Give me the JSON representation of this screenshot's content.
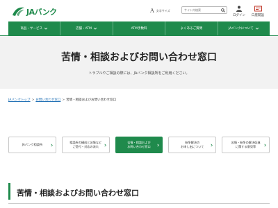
{
  "header": {
    "logo_text": "JAバンク",
    "font_size_label": "文字サイズ",
    "font_size_glyph": "A",
    "search": {
      "placeholder": "サイト内検索"
    },
    "login_label": "ログイン",
    "account_label": "口座開設",
    "accent_color": "#1f8a4c"
  },
  "nav": {
    "items": [
      {
        "label": "商品・サービス"
      },
      {
        "label": "店舗・ATM"
      },
      {
        "label": "ATM手数料"
      },
      {
        "label": "よくあるご質問"
      },
      {
        "label": "JAバンクについて"
      }
    ]
  },
  "hero": {
    "title": "苦情・相談およびお問い合わせ窓口",
    "subtitle": "トラブルやご相談の際には、JAバンク相談所をご利用ください。"
  },
  "breadcrumb": {
    "items": [
      "JAバンクトップ",
      "お問い合わせ窓口",
      "苦情・相談およびお問い合わせ窓口"
    ]
  },
  "tabs": {
    "items": [
      {
        "line1": "JAバンク相談所",
        "line2": ""
      },
      {
        "line1": "相談所の構成と苦情など",
        "line2": "ご受付・対応の流れ"
      },
      {
        "line1": "苦情・相談および",
        "line2": "お問い合わせ窓口"
      },
      {
        "line1": "紛争解決の",
        "line2": "お申し出について"
      },
      {
        "line1": "苦情・紛争の解決促進",
        "line2": "に関する意見等"
      }
    ]
  },
  "section": {
    "title": "苦情・相談およびお問い合わせ窓口"
  }
}
